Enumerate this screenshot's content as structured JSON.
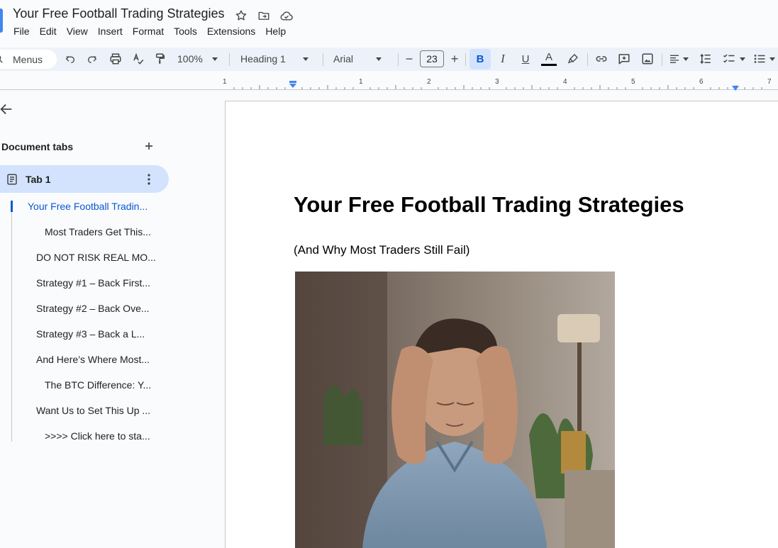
{
  "document": {
    "title": "Your Free Football Trading Strategies"
  },
  "menubar": [
    "File",
    "Edit",
    "View",
    "Insert",
    "Format",
    "Tools",
    "Extensions",
    "Help"
  ],
  "toolbar": {
    "menus_label": "Menus",
    "zoom": "100%",
    "style": "Heading 1",
    "font": "Arial",
    "font_size": "23",
    "bold_label": "B",
    "italic_label": "I",
    "underline_label": "U",
    "text_color_label": "A"
  },
  "ruler": {
    "labels": [
      "1",
      "1",
      "2",
      "3",
      "4",
      "5",
      "6",
      "7"
    ]
  },
  "sidebar": {
    "header": "Document tabs",
    "tab_label": "Tab 1",
    "outline": [
      {
        "label": "Your Free Football Tradin...",
        "active": true,
        "level": 1
      },
      {
        "label": "Most Traders Get This...",
        "active": false,
        "level": 2
      },
      {
        "label": "DO NOT RISK REAL MO...",
        "active": false,
        "level": 1
      },
      {
        "label": "Strategy #1 – Back First...",
        "active": false,
        "level": 1
      },
      {
        "label": "Strategy #2 – Back Ove...",
        "active": false,
        "level": 1
      },
      {
        "label": "Strategy #3 – Back a L...",
        "active": false,
        "level": 1
      },
      {
        "label": "And Here’s Where Most...",
        "active": false,
        "level": 1
      },
      {
        "label": "The BTC Difference: Y...",
        "active": false,
        "level": 2
      },
      {
        "label": "Want Us to Set This Up ...",
        "active": false,
        "level": 1
      },
      {
        "label": ">>>> Click here to sta...",
        "active": false,
        "level": 2
      }
    ]
  },
  "content": {
    "heading": "Your Free Football Trading Strategies",
    "subtitle": "(And Why Most Traders Still Fail)"
  },
  "colors": {
    "accent": "#0b57d0",
    "selected_bg": "#d3e3fd",
    "toolbar_bg": "#edf2fa"
  }
}
